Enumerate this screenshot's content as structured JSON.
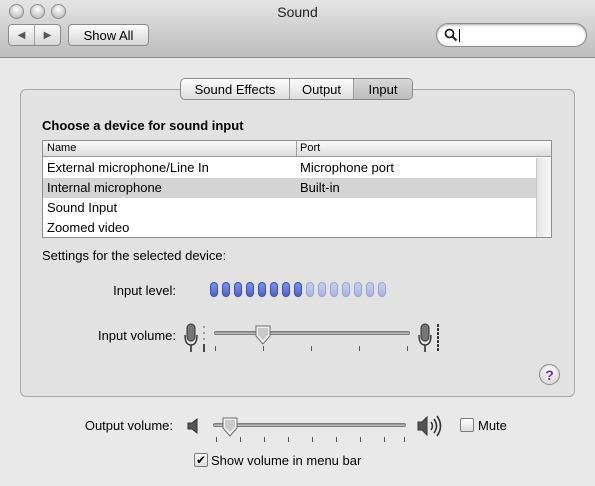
{
  "window": {
    "title": "Sound"
  },
  "toolbar": {
    "show_all_label": "Show All",
    "search": {
      "value": "",
      "placeholder": ""
    }
  },
  "tabs": [
    {
      "label": "Sound Effects",
      "selected": false
    },
    {
      "label": "Output",
      "selected": false
    },
    {
      "label": "Input",
      "selected": true
    }
  ],
  "input": {
    "heading": "Choose a device for sound input",
    "columns": {
      "name": "Name",
      "port": "Port"
    },
    "devices": [
      {
        "name": "External microphone/Line In",
        "port": "Microphone port"
      },
      {
        "name": "Internal microphone",
        "port": "Built-in"
      },
      {
        "name": "Sound Input",
        "port": ""
      },
      {
        "name": "Zoomed video",
        "port": ""
      }
    ],
    "selected_device_index": 1,
    "settings_heading": "Settings for the selected device:",
    "input_level_label": "Input level:",
    "input_level": {
      "lit_segments": 8,
      "total_segments": 15
    },
    "input_volume_label": "Input volume:",
    "input_volume": 0.25
  },
  "output": {
    "output_volume_label": "Output volume:",
    "output_volume": 0.09,
    "mute_label": "Mute",
    "mute_checked": false,
    "show_volume_label": "Show volume in menu bar",
    "show_volume_checked": true
  },
  "help": {
    "glyph": "?"
  },
  "colors": {
    "meter_on": "#4a62c9",
    "meter_off": "#aab6e6",
    "help_glyph": "#6a2fb5"
  }
}
